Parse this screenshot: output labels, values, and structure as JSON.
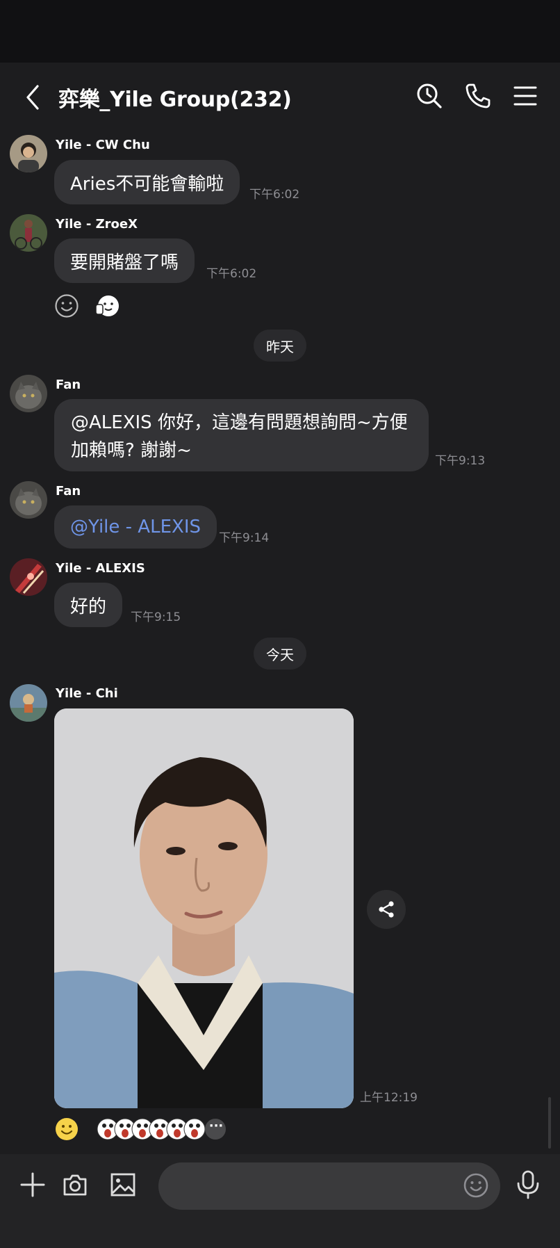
{
  "header": {
    "title": "弈樂_Yile Group(232)"
  },
  "messages": [
    {
      "sender": "Yile - CW Chu",
      "text": "Aries不可能會輸啦",
      "time": "下午6:02"
    },
    {
      "sender": "Yile - ZroeX",
      "text": "要開賭盤了嗎",
      "time": "下午6:02"
    },
    {
      "sender": "Fan",
      "text": "@ALEXIS 你好，這邊有問題想詢問~方便加賴嗎? 謝謝~",
      "time": "下午9:13"
    },
    {
      "sender": "Fan",
      "text": "@Yile - ALEXIS",
      "time": "下午9:14"
    },
    {
      "sender": "Yile - ALEXIS",
      "text": "好的",
      "time": "下午9:15"
    },
    {
      "sender": "Yile - Chi",
      "time": "上午12:19"
    }
  ],
  "date_dividers": [
    "昨天",
    "今天"
  ],
  "reactions": {
    "more_label": "···"
  },
  "input": {
    "placeholder": ""
  },
  "colors": {
    "background": "#1d1d1f",
    "bubble": "#333336",
    "mention": "#6f95e8",
    "timestamp": "#8e8e93"
  }
}
